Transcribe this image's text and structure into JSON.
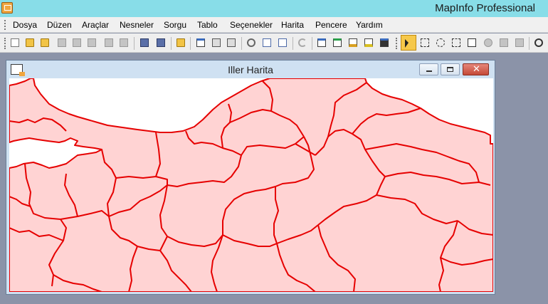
{
  "app": {
    "title": "MapInfo Professional",
    "icon": "mapinfo-app-icon"
  },
  "menu": {
    "items": [
      "Dosya",
      "Düzen",
      "Araçlar",
      "Nesneler",
      "Sorgu",
      "Tablo",
      "Seçenekler",
      "Harita",
      "Pencere",
      "Yardım"
    ]
  },
  "toolbar": {
    "tools": [
      {
        "name": "new-document-icon"
      },
      {
        "name": "open-folder-icon"
      },
      {
        "name": "open-workspace-icon"
      },
      {
        "name": "close-table-icon"
      },
      {
        "name": "close-all-icon"
      },
      {
        "name": "save-table-icon"
      },
      {
        "name": "zoom-search-icon"
      },
      {
        "name": "zoom-out-search-icon"
      },
      {
        "name": "save-icon"
      },
      {
        "name": "save-as-icon"
      },
      {
        "name": "open-folder-2-icon"
      },
      {
        "name": "layout-icon"
      },
      {
        "name": "print-icon"
      },
      {
        "name": "export-pdf-icon"
      },
      {
        "name": "cut-icon"
      },
      {
        "name": "copy-icon"
      },
      {
        "name": "paste-icon"
      },
      {
        "name": "undo-icon"
      },
      {
        "name": "new-browser-icon"
      },
      {
        "name": "new-mapper-icon"
      },
      {
        "name": "new-grapher-icon"
      },
      {
        "name": "new-layout-icon"
      },
      {
        "name": "new-redistrict-icon"
      },
      {
        "name": "select-arrow-icon"
      },
      {
        "name": "marquee-select-icon"
      },
      {
        "name": "radius-select-icon"
      },
      {
        "name": "polygon-select-icon"
      },
      {
        "name": "boundary-select-icon"
      },
      {
        "name": "unselect-icon"
      },
      {
        "name": "invert-selection-icon"
      },
      {
        "name": "graph-select-icon"
      },
      {
        "name": "zoom-in-icon"
      }
    ]
  },
  "map_window": {
    "title": "Iller Harita",
    "controls": {
      "minimize": "minimize-icon",
      "maximize": "maximize-icon",
      "close": "✕"
    },
    "colors": {
      "province_fill": "#ffd3d3",
      "province_border": "#e60000",
      "sea": "#ffffff"
    }
  }
}
